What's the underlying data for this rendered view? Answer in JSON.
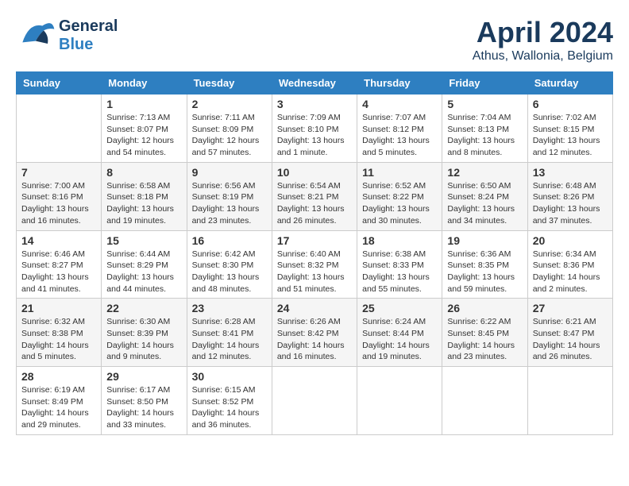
{
  "header": {
    "logo_general": "General",
    "logo_blue": "Blue",
    "title": "April 2024",
    "subtitle": "Athus, Wallonia, Belgium"
  },
  "calendar": {
    "days_of_week": [
      "Sunday",
      "Monday",
      "Tuesday",
      "Wednesday",
      "Thursday",
      "Friday",
      "Saturday"
    ],
    "weeks": [
      [
        {
          "day": "",
          "info": ""
        },
        {
          "day": "1",
          "info": "Sunrise: 7:13 AM\nSunset: 8:07 PM\nDaylight: 12 hours\nand 54 minutes."
        },
        {
          "day": "2",
          "info": "Sunrise: 7:11 AM\nSunset: 8:09 PM\nDaylight: 12 hours\nand 57 minutes."
        },
        {
          "day": "3",
          "info": "Sunrise: 7:09 AM\nSunset: 8:10 PM\nDaylight: 13 hours\nand 1 minute."
        },
        {
          "day": "4",
          "info": "Sunrise: 7:07 AM\nSunset: 8:12 PM\nDaylight: 13 hours\nand 5 minutes."
        },
        {
          "day": "5",
          "info": "Sunrise: 7:04 AM\nSunset: 8:13 PM\nDaylight: 13 hours\nand 8 minutes."
        },
        {
          "day": "6",
          "info": "Sunrise: 7:02 AM\nSunset: 8:15 PM\nDaylight: 13 hours\nand 12 minutes."
        }
      ],
      [
        {
          "day": "7",
          "info": "Sunrise: 7:00 AM\nSunset: 8:16 PM\nDaylight: 13 hours\nand 16 minutes."
        },
        {
          "day": "8",
          "info": "Sunrise: 6:58 AM\nSunset: 8:18 PM\nDaylight: 13 hours\nand 19 minutes."
        },
        {
          "day": "9",
          "info": "Sunrise: 6:56 AM\nSunset: 8:19 PM\nDaylight: 13 hours\nand 23 minutes."
        },
        {
          "day": "10",
          "info": "Sunrise: 6:54 AM\nSunset: 8:21 PM\nDaylight: 13 hours\nand 26 minutes."
        },
        {
          "day": "11",
          "info": "Sunrise: 6:52 AM\nSunset: 8:22 PM\nDaylight: 13 hours\nand 30 minutes."
        },
        {
          "day": "12",
          "info": "Sunrise: 6:50 AM\nSunset: 8:24 PM\nDaylight: 13 hours\nand 34 minutes."
        },
        {
          "day": "13",
          "info": "Sunrise: 6:48 AM\nSunset: 8:26 PM\nDaylight: 13 hours\nand 37 minutes."
        }
      ],
      [
        {
          "day": "14",
          "info": "Sunrise: 6:46 AM\nSunset: 8:27 PM\nDaylight: 13 hours\nand 41 minutes."
        },
        {
          "day": "15",
          "info": "Sunrise: 6:44 AM\nSunset: 8:29 PM\nDaylight: 13 hours\nand 44 minutes."
        },
        {
          "day": "16",
          "info": "Sunrise: 6:42 AM\nSunset: 8:30 PM\nDaylight: 13 hours\nand 48 minutes."
        },
        {
          "day": "17",
          "info": "Sunrise: 6:40 AM\nSunset: 8:32 PM\nDaylight: 13 hours\nand 51 minutes."
        },
        {
          "day": "18",
          "info": "Sunrise: 6:38 AM\nSunset: 8:33 PM\nDaylight: 13 hours\nand 55 minutes."
        },
        {
          "day": "19",
          "info": "Sunrise: 6:36 AM\nSunset: 8:35 PM\nDaylight: 13 hours\nand 59 minutes."
        },
        {
          "day": "20",
          "info": "Sunrise: 6:34 AM\nSunset: 8:36 PM\nDaylight: 14 hours\nand 2 minutes."
        }
      ],
      [
        {
          "day": "21",
          "info": "Sunrise: 6:32 AM\nSunset: 8:38 PM\nDaylight: 14 hours\nand 5 minutes."
        },
        {
          "day": "22",
          "info": "Sunrise: 6:30 AM\nSunset: 8:39 PM\nDaylight: 14 hours\nand 9 minutes."
        },
        {
          "day": "23",
          "info": "Sunrise: 6:28 AM\nSunset: 8:41 PM\nDaylight: 14 hours\nand 12 minutes."
        },
        {
          "day": "24",
          "info": "Sunrise: 6:26 AM\nSunset: 8:42 PM\nDaylight: 14 hours\nand 16 minutes."
        },
        {
          "day": "25",
          "info": "Sunrise: 6:24 AM\nSunset: 8:44 PM\nDaylight: 14 hours\nand 19 minutes."
        },
        {
          "day": "26",
          "info": "Sunrise: 6:22 AM\nSunset: 8:45 PM\nDaylight: 14 hours\nand 23 minutes."
        },
        {
          "day": "27",
          "info": "Sunrise: 6:21 AM\nSunset: 8:47 PM\nDaylight: 14 hours\nand 26 minutes."
        }
      ],
      [
        {
          "day": "28",
          "info": "Sunrise: 6:19 AM\nSunset: 8:49 PM\nDaylight: 14 hours\nand 29 minutes."
        },
        {
          "day": "29",
          "info": "Sunrise: 6:17 AM\nSunset: 8:50 PM\nDaylight: 14 hours\nand 33 minutes."
        },
        {
          "day": "30",
          "info": "Sunrise: 6:15 AM\nSunset: 8:52 PM\nDaylight: 14 hours\nand 36 minutes."
        },
        {
          "day": "",
          "info": ""
        },
        {
          "day": "",
          "info": ""
        },
        {
          "day": "",
          "info": ""
        },
        {
          "day": "",
          "info": ""
        }
      ]
    ]
  }
}
